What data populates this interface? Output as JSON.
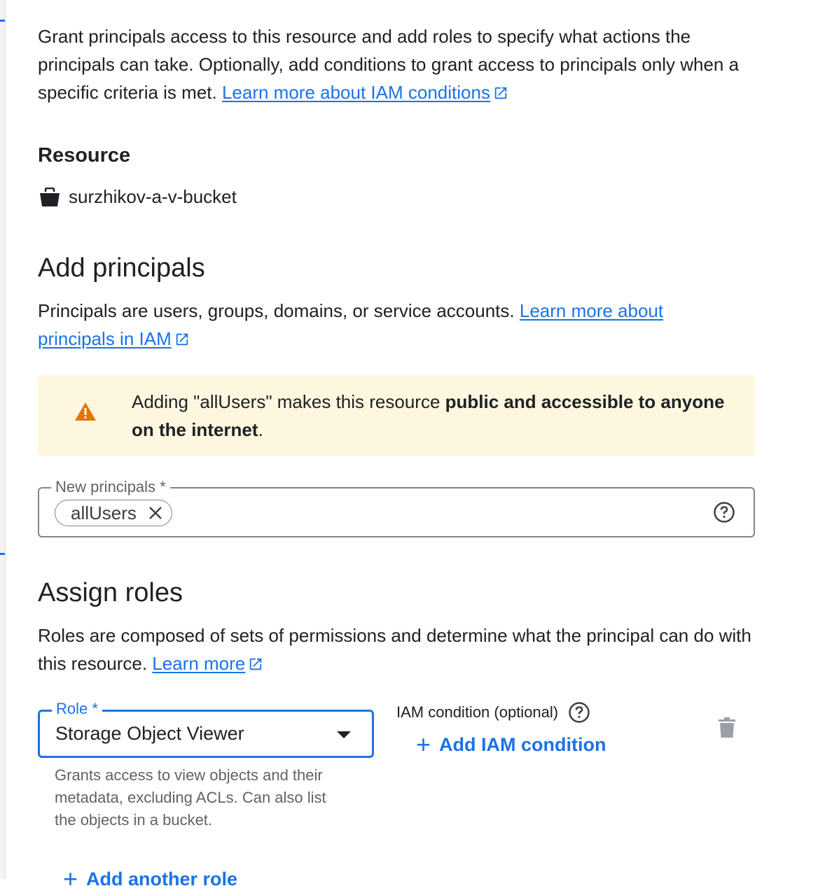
{
  "intro": {
    "text": "Grant principals access to this resource and add roles to specify what actions the principals can take. Optionally, add conditions to grant access to principals only when a specific criteria is met. ",
    "link": "Learn more about IAM conditions"
  },
  "resource": {
    "heading": "Resource",
    "name": "surzhikov-a-v-bucket"
  },
  "add_principals": {
    "heading": "Add principals",
    "desc": "Principals are users, groups, domains, or service accounts. ",
    "link": "Learn more about principals in IAM",
    "warning": {
      "pre": "Adding \"allUsers\" makes this resource ",
      "bold": "public and accessible to anyone on the internet",
      "post": "."
    },
    "field_label": "New principals *",
    "chips": [
      "allUsers"
    ]
  },
  "assign_roles": {
    "heading": "Assign roles",
    "desc": "Roles are composed of sets of permissions and determine what the principal can do with this resource. ",
    "link": "Learn more",
    "role_label": "Role *",
    "role_value": "Storage Object Viewer",
    "role_help": "Grants access to view objects and their metadata, excluding ACLs. Can also list the objects in a bucket.",
    "condition_label": "IAM condition (optional)",
    "add_condition": "Add IAM condition",
    "add_another_role": "Add another role"
  },
  "colors": {
    "link": "#1a73e8",
    "warning_bg": "#fef7e0",
    "warning_icon": "#e37400"
  }
}
